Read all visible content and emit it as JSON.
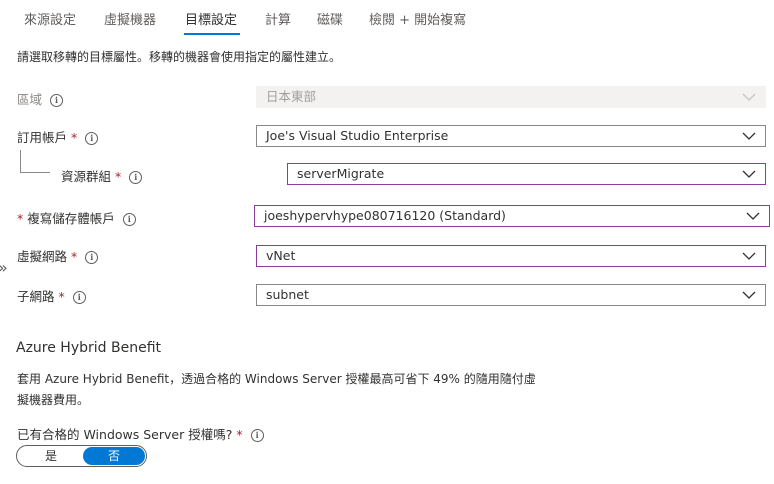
{
  "tabs": [
    {
      "label": "來源設定"
    },
    {
      "label": "虛擬機器"
    },
    {
      "label": "目標設定",
      "active": true
    },
    {
      "label": "計算"
    },
    {
      "label": "磁碟"
    },
    {
      "label": "檢閱 + 開始複寫"
    }
  ],
  "description": "請選取移轉的目標屬性。移轉的機器會使用指定的屬性建立。",
  "fields": {
    "region": {
      "label": "區域",
      "value": "日本東部",
      "disabled": true
    },
    "subscription": {
      "label": "訂用帳戶",
      "required": "*",
      "value": "Joe's Visual Studio Enterprise"
    },
    "resource_group": {
      "label": "資源群組",
      "required": "*",
      "value": "serverMigrate"
    },
    "storage_account": {
      "label": "複寫儲存體帳戶",
      "required": "*",
      "value": "joeshypervhype080716120 (Standard)"
    },
    "vnet": {
      "label": "虛擬網路",
      "required": "*",
      "value": "vNet"
    },
    "subnet": {
      "label": "子網路",
      "required": "*",
      "value": "subnet"
    }
  },
  "hybrid": {
    "title": "Azure Hybrid Benefit",
    "text": "套用 Azure Hybrid Benefit，透過合格的 Windows Server 授權最高可省下 49% 的隨用隨付虛擬機器費用。",
    "question": "已有合格的 Windows Server 授權嗎?",
    "required": "*",
    "toggle": {
      "yes": "是",
      "no": "否",
      "selected": "否"
    }
  },
  "icons": {
    "info": "info-icon",
    "chevron": "chevron-down-icon",
    "expand": "double-chevron-right-icon"
  },
  "colors": {
    "accent": "#0078d4",
    "focus_border": "#8a3c9f",
    "required": "#a4262c"
  }
}
